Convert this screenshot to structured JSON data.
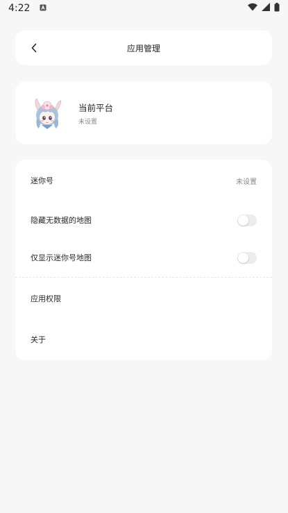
{
  "status_bar": {
    "time": "4:22",
    "notification_icon": "a-notification-icon",
    "wifi_icon": "wifi-icon",
    "signal_icon": "signal-icon",
    "battery_icon": "battery-icon"
  },
  "header": {
    "back_icon": "chevron-left-icon",
    "title": "应用管理"
  },
  "platform": {
    "title": "当前平台",
    "subtitle": "未设置",
    "avatar": "anime-character-avatar"
  },
  "settings": {
    "mini_id": {
      "label": "迷你号",
      "value": "未设置"
    },
    "hide_no_data_maps": {
      "label": "隐藏无数据的地图",
      "enabled": false
    },
    "show_only_mini_maps": {
      "label": "仅显示迷你号地图",
      "enabled": false
    },
    "app_permissions": {
      "label": "应用权限"
    },
    "about": {
      "label": "关于"
    }
  },
  "colors": {
    "background": "#f7f7f7",
    "card": "#ffffff",
    "toggle_off": "#ececec",
    "secondary_text": "#8a8a8a"
  }
}
